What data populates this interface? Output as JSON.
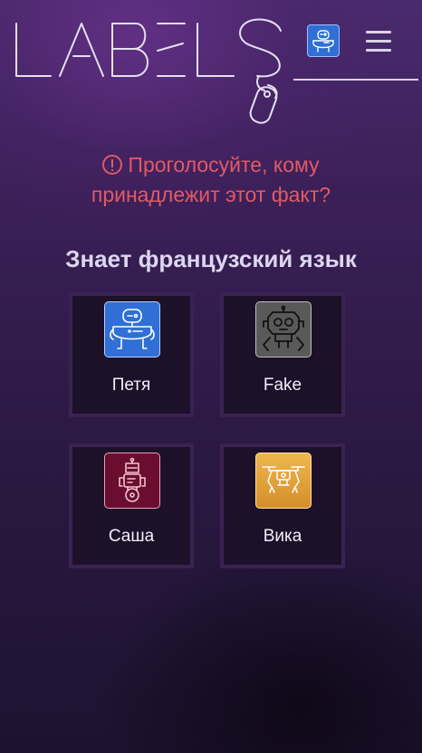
{
  "header": {
    "logo_text": "LABELS",
    "avatar_icon": "robot-icon",
    "menu_icon": "hamburger-menu-icon"
  },
  "prompt": {
    "icon": "alert-circle-icon",
    "line1": "Проголосуйте, кому",
    "line2": "принадлежит этот факт?",
    "color": "#e25a63"
  },
  "fact": {
    "text": "Знает французский язык"
  },
  "players": [
    {
      "name": "Петя",
      "avatar_icon": "robot-icon",
      "tile_color": "#2f6fd6"
    },
    {
      "name": "Fake",
      "avatar_icon": "robot-head-icon",
      "tile_color": "#5b5b5b"
    },
    {
      "name": "Саша",
      "avatar_icon": "robot-wheel-icon",
      "tile_color": "#6a0d2e"
    },
    {
      "name": "Вика",
      "avatar_icon": "drone-icon",
      "tile_color": "#e3a43a"
    }
  ]
}
